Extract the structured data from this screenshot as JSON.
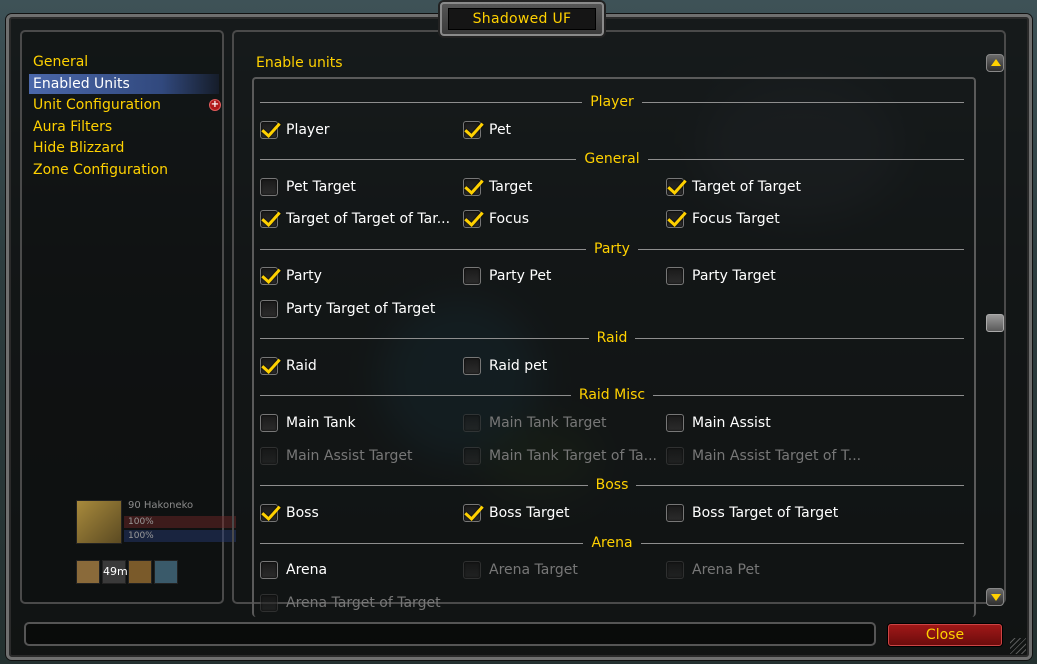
{
  "window": {
    "title": "Shadowed UF"
  },
  "nav": {
    "items": [
      {
        "label": "General",
        "selected": false,
        "expandable": false
      },
      {
        "label": "Enabled Units",
        "selected": true,
        "expandable": false
      },
      {
        "label": "Unit Configuration",
        "selected": false,
        "expandable": true
      },
      {
        "label": "Aura Filters",
        "selected": false,
        "expandable": false
      },
      {
        "label": "Hide Blizzard",
        "selected": false,
        "expandable": false
      },
      {
        "label": "Zone Configuration",
        "selected": false,
        "expandable": false
      }
    ]
  },
  "content": {
    "heading": "Enable units",
    "groups": [
      {
        "label": "Player",
        "options": [
          {
            "label": "Player",
            "checked": true,
            "enabled": true
          },
          {
            "label": "Pet",
            "checked": true,
            "enabled": true
          }
        ]
      },
      {
        "label": "General",
        "options": [
          {
            "label": "Pet Target",
            "checked": false,
            "enabled": true
          },
          {
            "label": "Target",
            "checked": true,
            "enabled": true
          },
          {
            "label": "Target of Target",
            "checked": true,
            "enabled": true
          },
          {
            "label": "Target of Target of Tar...",
            "checked": true,
            "enabled": true
          },
          {
            "label": "Focus",
            "checked": true,
            "enabled": true
          },
          {
            "label": "Focus Target",
            "checked": true,
            "enabled": true
          }
        ]
      },
      {
        "label": "Party",
        "options": [
          {
            "label": "Party",
            "checked": true,
            "enabled": true
          },
          {
            "label": "Party Pet",
            "checked": false,
            "enabled": true
          },
          {
            "label": "Party Target",
            "checked": false,
            "enabled": true
          },
          {
            "label": "Party Target of Target",
            "checked": false,
            "enabled": true
          }
        ]
      },
      {
        "label": "Raid",
        "options": [
          {
            "label": "Raid",
            "checked": true,
            "enabled": true
          },
          {
            "label": "Raid pet",
            "checked": false,
            "enabled": true
          }
        ]
      },
      {
        "label": "Raid Misc",
        "options": [
          {
            "label": "Main Tank",
            "checked": false,
            "enabled": true
          },
          {
            "label": "Main Tank Target",
            "checked": false,
            "enabled": false
          },
          {
            "label": "Main Assist",
            "checked": false,
            "enabled": true
          },
          {
            "label": "Main Assist Target",
            "checked": false,
            "enabled": false
          },
          {
            "label": "Main Tank Target of Ta...",
            "checked": false,
            "enabled": false
          },
          {
            "label": "Main Assist Target of T...",
            "checked": false,
            "enabled": false
          }
        ]
      },
      {
        "label": "Boss",
        "options": [
          {
            "label": "Boss",
            "checked": true,
            "enabled": true
          },
          {
            "label": "Boss Target",
            "checked": true,
            "enabled": true
          },
          {
            "label": "Boss Target of Target",
            "checked": false,
            "enabled": true
          }
        ]
      },
      {
        "label": "Arena",
        "options": [
          {
            "label": "Arena",
            "checked": false,
            "enabled": true
          },
          {
            "label": "Arena Target",
            "checked": false,
            "enabled": false
          },
          {
            "label": "Arena Pet",
            "checked": false,
            "enabled": false
          },
          {
            "label": "Arena Target of Target",
            "checked": false,
            "enabled": false
          }
        ]
      }
    ]
  },
  "unitframe": {
    "name": "90 Hakoneko",
    "hp_text": "100%",
    "mp_text": "100%",
    "buff_text": "49m"
  },
  "footer": {
    "close_label": "Close",
    "status_text": ""
  },
  "colors": {
    "accent": "#ffd100",
    "selected_bg": "#4e6cb2",
    "close_bg": "#a01818"
  }
}
